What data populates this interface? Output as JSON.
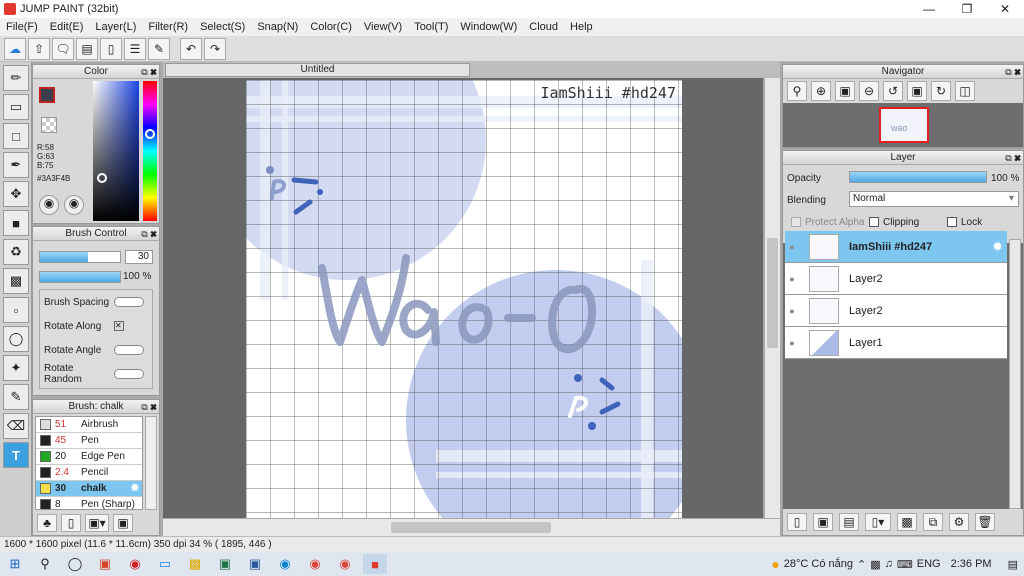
{
  "window": {
    "title": "JUMP PAINT (32bit)"
  },
  "menu": [
    "File(F)",
    "Edit(E)",
    "Layer(L)",
    "Filter(R)",
    "Select(S)",
    "Snap(N)",
    "Color(C)",
    "View(V)",
    "Tool(T)",
    "Window(W)",
    "Cloud",
    "Help"
  ],
  "toolbar": {
    "icons": [
      "cloud-icon",
      "share-icon",
      "speech-icon",
      "comment-icon",
      "page-icon",
      "list-icon",
      "edit-icon",
      "undo-icon",
      "redo-icon"
    ]
  },
  "tools": [
    "brush",
    "eraser",
    "rect-select",
    "pen",
    "move",
    "fill-rect",
    "bucket",
    "gradient",
    "lasso-select",
    "magic-select",
    "wand",
    "select-pen",
    "select-eraser",
    "text"
  ],
  "color_panel": {
    "title": "Color",
    "r": "R:58",
    "g": "G:63",
    "b": "B:75",
    "hex": "#3A3F4B",
    "fg_color": "#3A3F4B",
    "bg_color": "#ffffff"
  },
  "brush_control": {
    "title": "Brush Control",
    "size": "30",
    "opacity": "100 %",
    "rows": [
      "Brush Spacing",
      "Rotate Along",
      "Rotate Angle",
      "Rotate Random"
    ]
  },
  "brush_list": {
    "title": "Brush: chalk",
    "items": [
      {
        "size": "51",
        "name": "Airbrush",
        "color": "#dddddd"
      },
      {
        "size": "45",
        "name": "Pen",
        "color": "#222222"
      },
      {
        "size": "20",
        "name": "Edge Pen",
        "color": "#22aa22"
      },
      {
        "size": "2.4",
        "name": "Pencil",
        "color": "#222222"
      },
      {
        "size": "30",
        "name": "chalk",
        "color": "#f2e04a",
        "selected": true
      },
      {
        "size": "8",
        "name": "Pen (Sharp)",
        "color": "#222222"
      }
    ]
  },
  "document": {
    "tab": "Untitled",
    "watermark": "IamShiii #hd247",
    "main_text": "Wao-O"
  },
  "navigator": {
    "title": "Navigator"
  },
  "layer_panel": {
    "title": "Layer",
    "opacity_label": "Opacity",
    "opacity_value": "100 %",
    "blending_label": "Blending",
    "blending_value": "Normal",
    "protect_alpha": "Protect Alpha",
    "clipping": "Clipping",
    "lock": "Lock",
    "layers": [
      {
        "name": "IamShiii #hd247",
        "selected": true
      },
      {
        "name": "Layer2"
      },
      {
        "name": "Layer2"
      },
      {
        "name": "Layer1"
      }
    ]
  },
  "status": {
    "text": "1600 * 1600 pixel  (11.6 * 11.6cm)  350 dpi  34 %  ( 1895, 446 )"
  },
  "taskbar": {
    "weather": "28°C  Có nắng",
    "lang": "ENG",
    "time": "2:36 PM"
  },
  "colors": {
    "accent": "#7cc6f0",
    "canvas_bg": "#676767",
    "circle": "#c9d3f0"
  }
}
